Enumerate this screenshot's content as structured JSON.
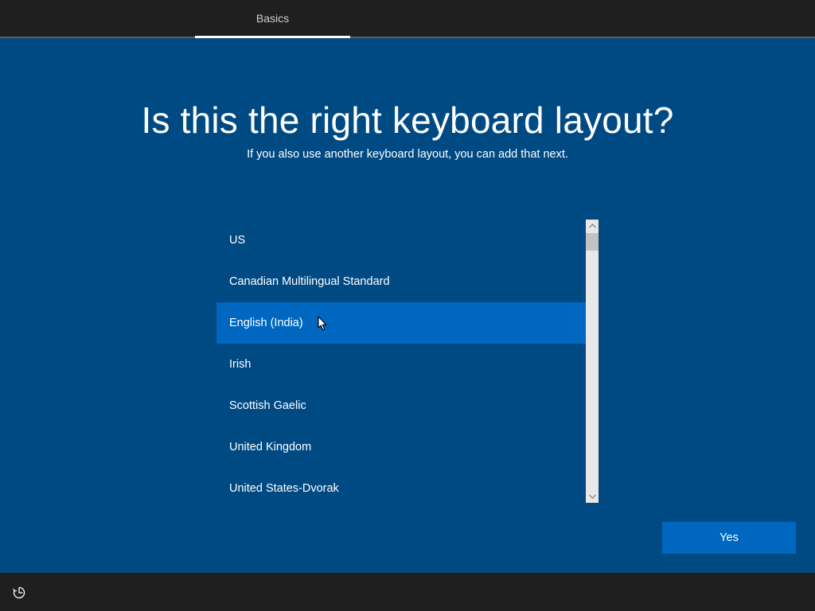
{
  "header": {
    "tab_label": "Basics"
  },
  "main": {
    "title": "Is this the right keyboard layout?",
    "subtitle": "If you also use another keyboard layout, you can add that next."
  },
  "keyboard_list": {
    "items": [
      {
        "label": "US"
      },
      {
        "label": "Canadian Multilingual Standard"
      },
      {
        "label": "English (India)"
      },
      {
        "label": "Irish"
      },
      {
        "label": "Scottish Gaelic"
      },
      {
        "label": "United Kingdom"
      },
      {
        "label": "United States-Dvorak"
      }
    ],
    "selected_label": "English (India)"
  },
  "footer": {
    "yes_label": "Yes",
    "accessibility_icon": "accessibility-icon"
  },
  "colors": {
    "background": "#004a84",
    "accent": "#0067c0",
    "bar": "#1f1f1f"
  }
}
